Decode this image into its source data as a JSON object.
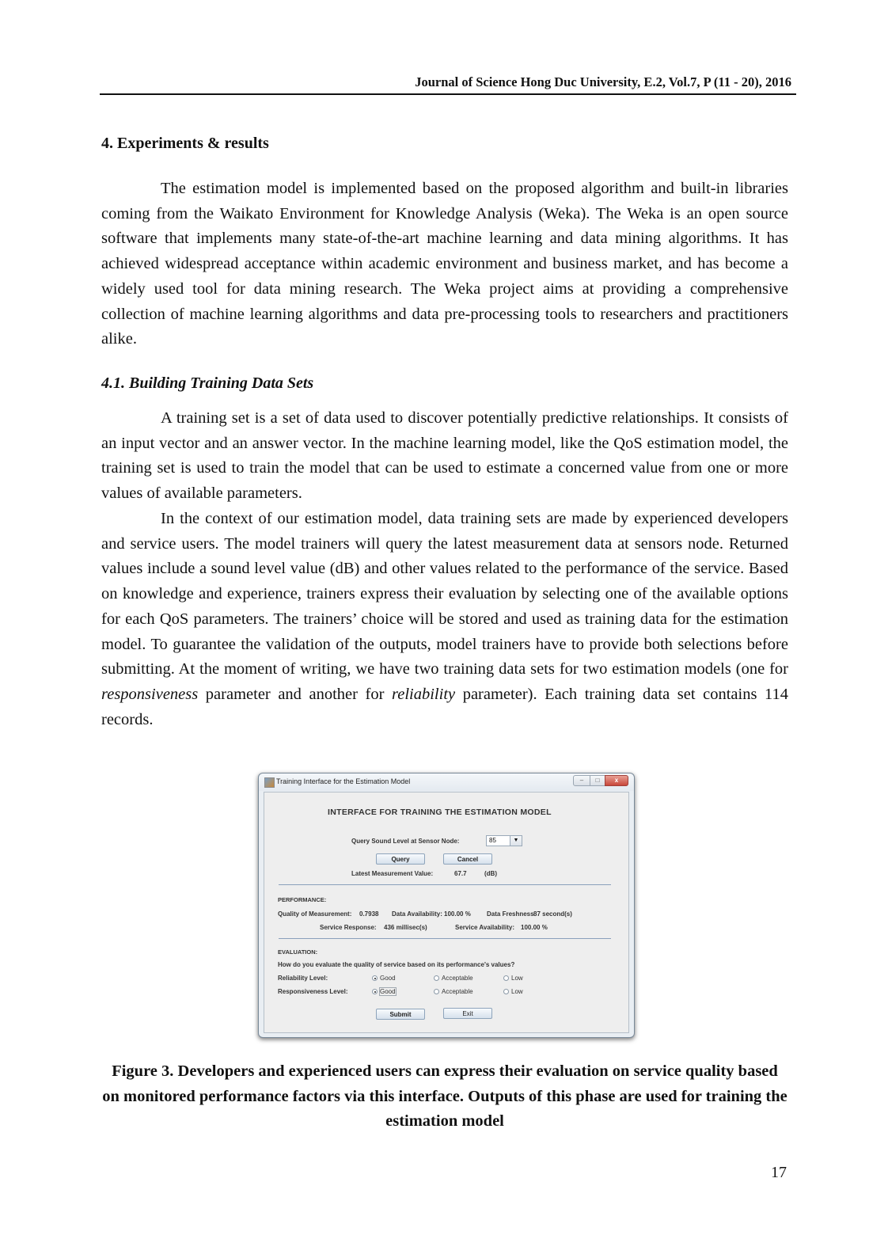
{
  "header": {
    "running_title": "Journal of Science Hong Duc University, E.2, Vol.7, P (11 - 20), 2016"
  },
  "section": {
    "heading": "4. Experiments & results",
    "paragraph": "The estimation model is implemented based on the proposed algorithm and built-in libraries coming from the Waikato Environment for Knowledge Analysis (Weka). The Weka is an open source software that implements many state-of-the-art machine learning and data mining algorithms. It has achieved widespread acceptance within academic environment and business market, and has become a widely used tool for data mining research. The Weka project aims at providing a comprehensive collection of machine learning algorithms and data pre-processing tools to researchers and practitioners alike."
  },
  "subsection": {
    "heading": "4.1. Building Training Data Sets",
    "paragraph1": "A training set is a set of data used to discover potentially predictive relationships. It consists of an input vector and an answer vector. In the machine learning model, like the QoS estimation model, the training set is used to train the model that can be used to estimate a concerned value from one or more values of available parameters.",
    "paragraph2_part1": "In the context of our estimation model, data training sets are made by experienced developers and service users. The model trainers will query the latest measurement data at sensors node. Returned values include a sound level value (dB) and other values related to the performance of the service. Based on knowledge and experience, trainers express their evaluation by selecting one of the available options for each QoS parameters. The trainers’ choice will be stored and used as training data for the estimation model. To guarantee the validation of the outputs, model trainers have to provide both selections before submitting. At the moment of writing, we have two training data sets for two estimation models (one for ",
    "paragraph2_em1": "responsiveness",
    "paragraph2_part2": " parameter and another for ",
    "paragraph2_em2": "reliability",
    "paragraph2_part3": " parameter). Each training data set contains 114 records."
  },
  "figure": {
    "window": {
      "title": "Training Interface for the Estimation Model",
      "controls": {
        "minimize": "–",
        "maximize": "□",
        "close": "x"
      },
      "main_title": "INTERFACE FOR TRAINING THE ESTIMATION MODEL",
      "query_label": "Query Sound Level at Sensor Node:",
      "query_value": "85",
      "query_button": "Query",
      "cancel_button": "Cancel",
      "latest_label": "Latest Measurement Value:",
      "latest_value": "67.7",
      "latest_unit": "(dB)",
      "performance": {
        "heading": "PERFORMANCE:",
        "quality_label": "Quality of Measurement:",
        "quality_value": "0.7938",
        "availability_label": "Data Availability:",
        "availability_value": "100.00 %",
        "freshness_label": "Data Freshness",
        "freshness_value": "87 second(s)",
        "response_label": "Service Response:",
        "response_value": "436 millisec(s)",
        "service_availability_label": "Service Availability:",
        "service_availability_value": "100.00 %"
      },
      "evaluation": {
        "heading": "EVALUATION:",
        "question": "How do you evaluate the quality of service based on its performance's values?",
        "rows": [
          {
            "label": "Reliability Level:",
            "options": [
              "Good",
              "Acceptable",
              "Low"
            ],
            "selected": "Good"
          },
          {
            "label": "Responsiveness Level:",
            "options": [
              "Good",
              "Acceptable",
              "Low"
            ],
            "selected": "Good"
          }
        ]
      },
      "submit_button": "Submit",
      "exit_button": "Exit"
    },
    "caption": "Figure 3. Developers and experienced users can express their evaluation on service quality based on monitored performance factors via this interface. Outputs of this phase are used for training the estimation model"
  },
  "page_number": "17"
}
